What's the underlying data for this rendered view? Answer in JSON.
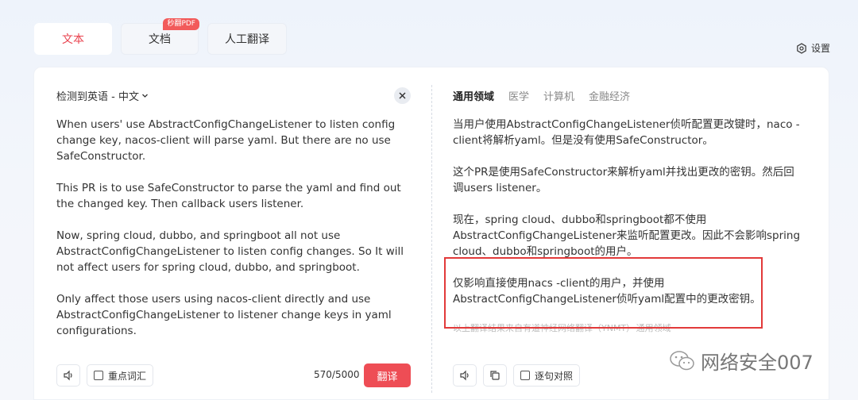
{
  "tabs": [
    {
      "label": "文本",
      "active": true
    },
    {
      "label": "文档",
      "badge": "秒翻PDF"
    },
    {
      "label": "人工翻译"
    }
  ],
  "settings_label": "设置",
  "source": {
    "language_selector": "检测到英语 - 中文",
    "paragraphs": [
      "When users' use AbstractConfigChangeListener to listen config change key, nacos-client will parse yaml. But there are no use SafeConstructor.",
      "This PR is to use SafeConstructor to parse the yaml and find out the changed key. Then callback users listener.",
      "Now, spring cloud, dubbo, and springboot all not use AbstractConfigChangeListener to listen config changes. So It will not affect users for spring cloud, dubbo, and springboot.",
      "Only affect those users using nacos-client directly and use AbstractConfigChangeListener to listener change keys in yaml configurations."
    ],
    "key_terms_label": "重点词汇",
    "char_count": "570/5000",
    "translate_button": "翻译"
  },
  "target": {
    "domain_tabs": [
      "通用领域",
      "医学",
      "计算机",
      "金融经济"
    ],
    "paragraphs": [
      "当用户使用AbstractConfigChangeListener侦听配置更改键时，naco -client将解析yaml。但是没有使用SafeConstructor。",
      "这个PR是使用SafeConstructor来解析yaml并找出更改的密钥。然后回调users listener。",
      "现在，spring cloud、dubbo和springboot都不使用AbstractConfigChangeListener来监听配置更改。因此不会影响spring cloud、dubbo和springboot的用户。",
      "仅影响直接使用nacs -client的用户，并使用AbstractConfigChangeListener侦听yaml配置中的更改密钥。"
    ],
    "footnote": "以上翻译结果来自有道神经网络翻译（YNMT）· 通用领域",
    "sentence_compare_label": "逐句对照"
  },
  "watermark": "网络安全007",
  "colors": {
    "accent": "#ee4d55",
    "highlight_box": "#e23a3a"
  }
}
